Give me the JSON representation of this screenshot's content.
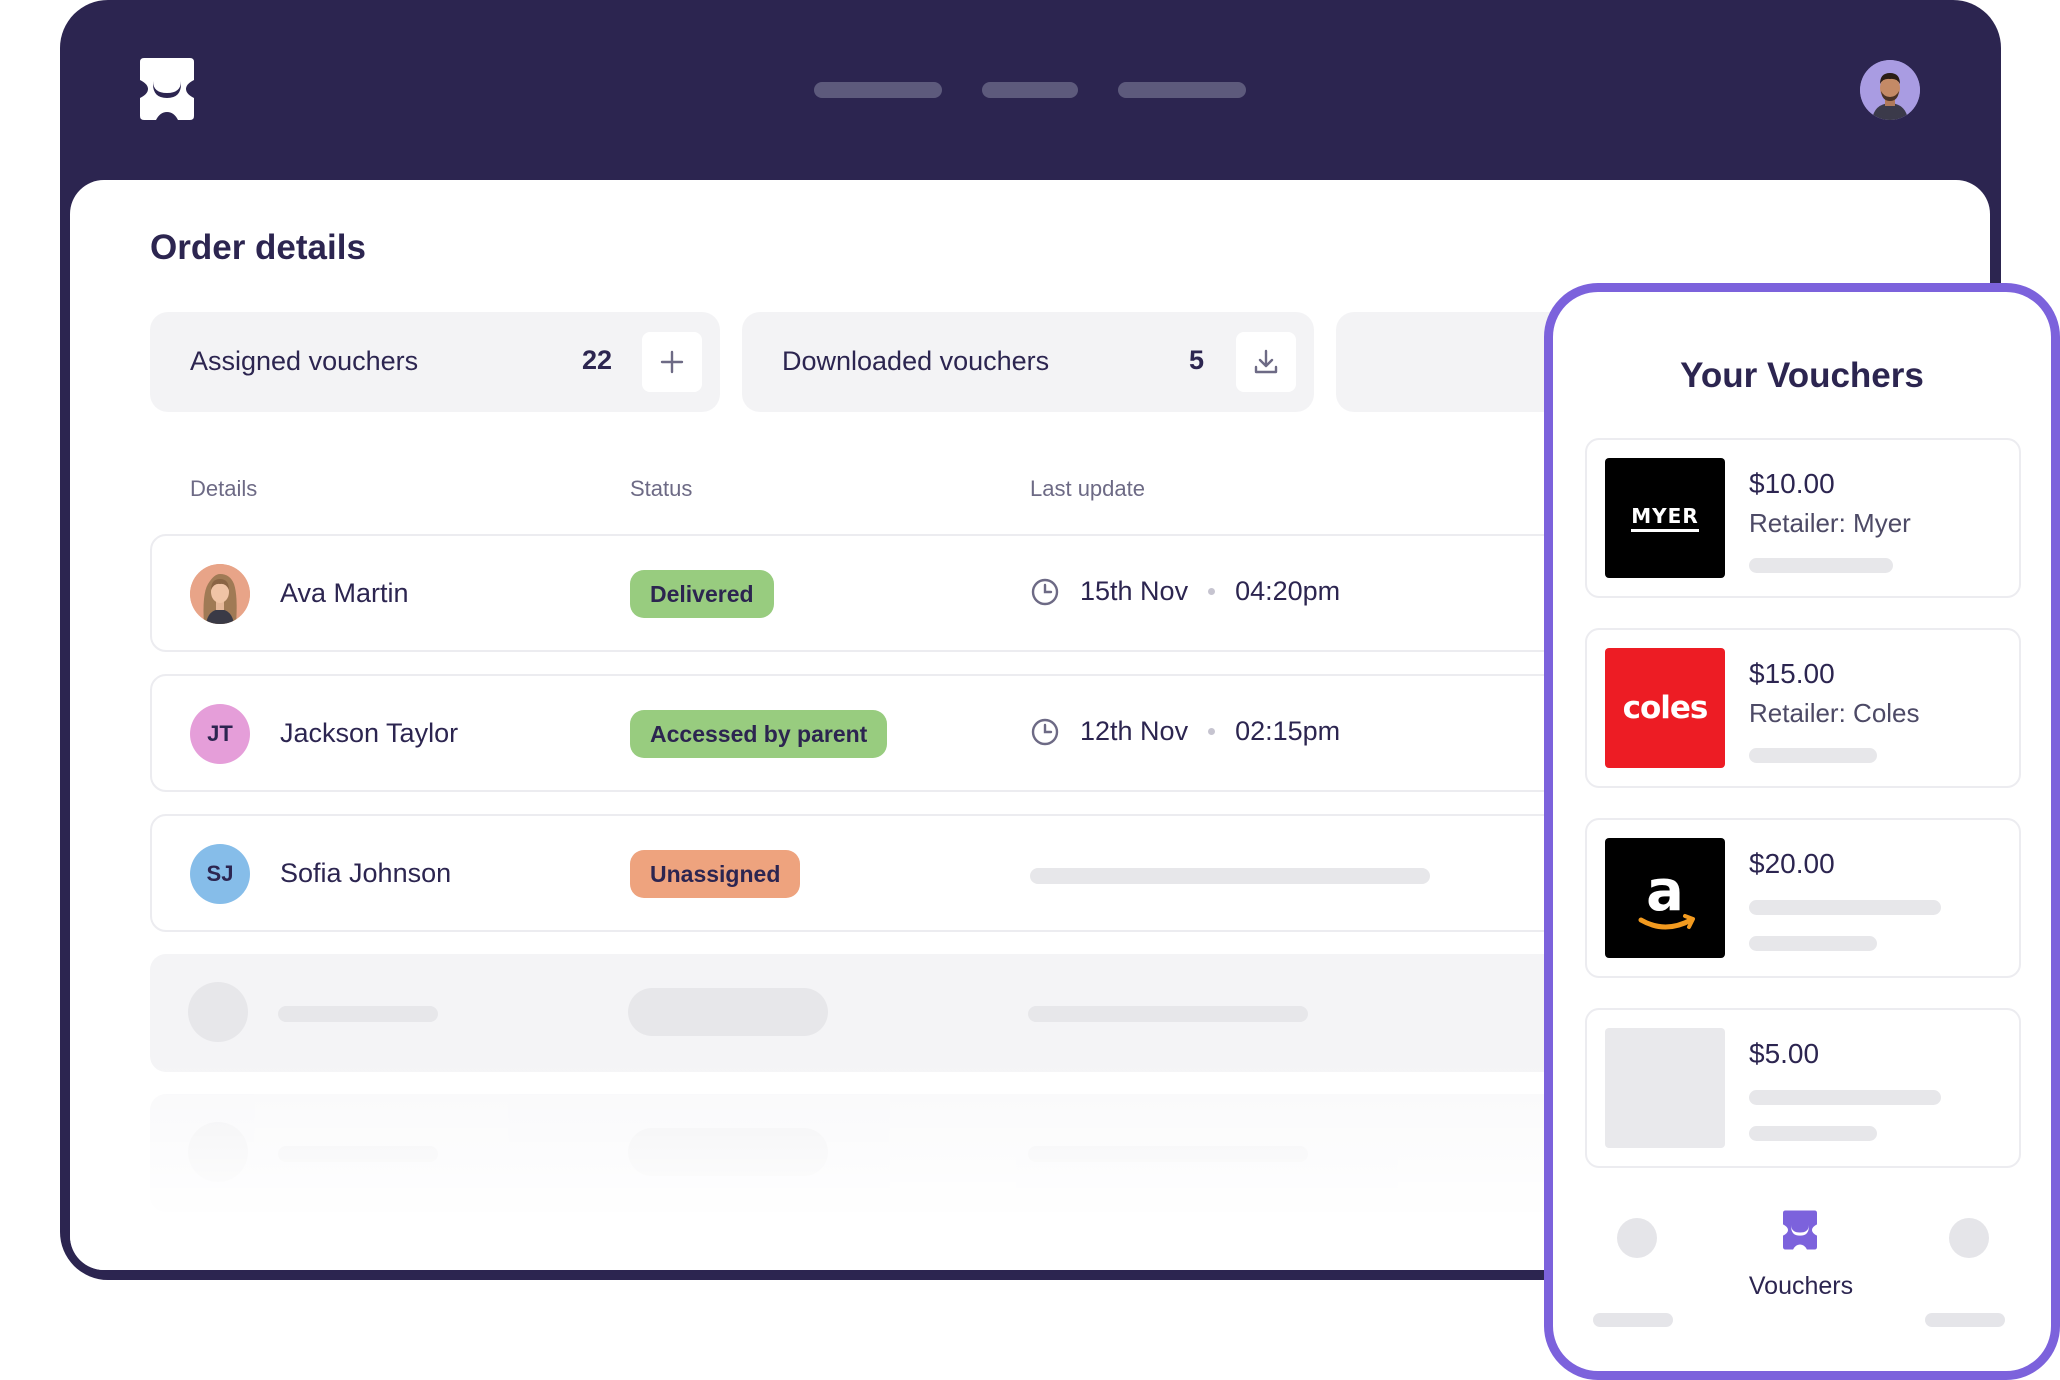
{
  "header": {
    "logo_icon": "voucher-logo-icon",
    "profile_icon": "profile-avatar"
  },
  "page": {
    "title": "Order details"
  },
  "stats": [
    {
      "label": "Assigned vouchers",
      "value": "22",
      "action_icon": "plus-icon"
    },
    {
      "label": "Downloaded vouchers",
      "value": "5",
      "action_icon": "download-icon"
    }
  ],
  "table": {
    "columns": [
      "Details",
      "Status",
      "Last update"
    ],
    "rows": [
      {
        "name": "Ava Martin",
        "initials": "",
        "avatar": "photo",
        "status": "Delivered",
        "status_color": "#98cc7f",
        "date": "15th Nov",
        "time": "04:20pm"
      },
      {
        "name": "Jackson Taylor",
        "initials": "JT",
        "avatar_color": "#e59ed9",
        "status": "Accessed by parent",
        "status_color": "#98cc7f",
        "date": "12th Nov",
        "time": "02:15pm"
      },
      {
        "name": "Sofia Johnson",
        "initials": "SJ",
        "avatar_color": "#86bde9",
        "status": "Unassigned",
        "status_color": "#eea37e",
        "date": "",
        "time": ""
      }
    ]
  },
  "phone": {
    "title": "Your Vouchers",
    "vouchers": [
      {
        "amount": "$10.00",
        "retailer": "Retailer: Myer",
        "logo_text": "MYER"
      },
      {
        "amount": "$15.00",
        "retailer": "Retailer: Coles",
        "logo_text": "coles"
      },
      {
        "amount": "$20.00",
        "retailer": "",
        "logo_text": "a"
      },
      {
        "amount": "$5.00",
        "retailer": "",
        "logo_text": ""
      }
    ],
    "tabbar": {
      "active_label": "Vouchers"
    }
  },
  "colors": {
    "brand_dark": "#2c2550",
    "accent_purple": "#7c62dc",
    "status_green": "#98cc7f",
    "status_orange": "#eea37e",
    "coles_red": "#ed1c24"
  }
}
